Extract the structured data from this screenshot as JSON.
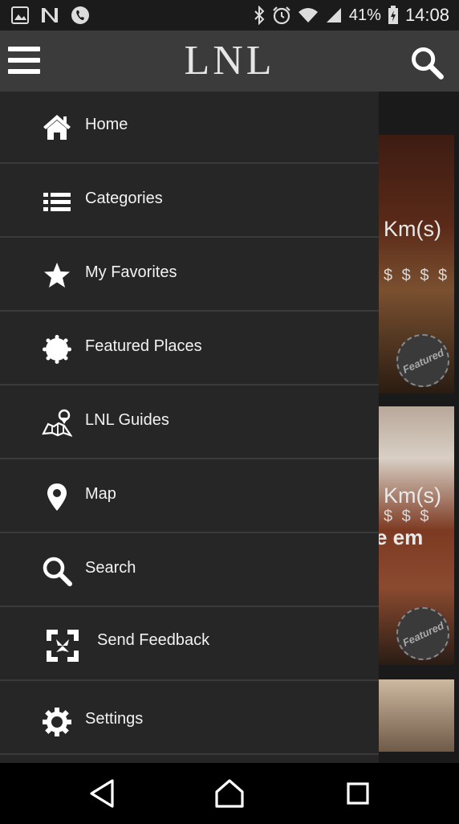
{
  "status_bar": {
    "battery_percent": "41%",
    "time": "14:08",
    "icons": [
      "image-icon",
      "n-icon",
      "phone-icon",
      "bluetooth-icon",
      "alarm-icon",
      "wifi-icon",
      "signal-icon",
      "battery-icon"
    ]
  },
  "header": {
    "logo": "LNL",
    "icons": [
      "hamburger-menu-icon",
      "search-icon"
    ]
  },
  "drawer": {
    "items": [
      {
        "label": "Home",
        "icon": "home-icon"
      },
      {
        "label": "Categories",
        "icon": "list-icon"
      },
      {
        "label": "My Favorites",
        "icon": "star-icon"
      },
      {
        "label": "Featured Places",
        "icon": "badge-icon"
      },
      {
        "label": "LNL Guides",
        "icon": "map-guide-icon"
      },
      {
        "label": "Map",
        "icon": "location-pin-icon"
      },
      {
        "label": "Search",
        "icon": "search-icon"
      },
      {
        "label": "Send Feedback",
        "icon": "feedback-icon"
      },
      {
        "label": "Settings",
        "icon": "gear-icon"
      }
    ]
  },
  "background": {
    "cards": [
      {
        "distance": "Km(s)",
        "price": "$ $ $ $",
        "badge": "Featured"
      },
      {
        "distance": "Km(s)",
        "price": "$ $ $",
        "title_fragment": "e em",
        "badge": "Featured"
      }
    ]
  },
  "nav_bar": {
    "icons": [
      "back-icon",
      "home-nav-icon",
      "recents-icon"
    ]
  }
}
